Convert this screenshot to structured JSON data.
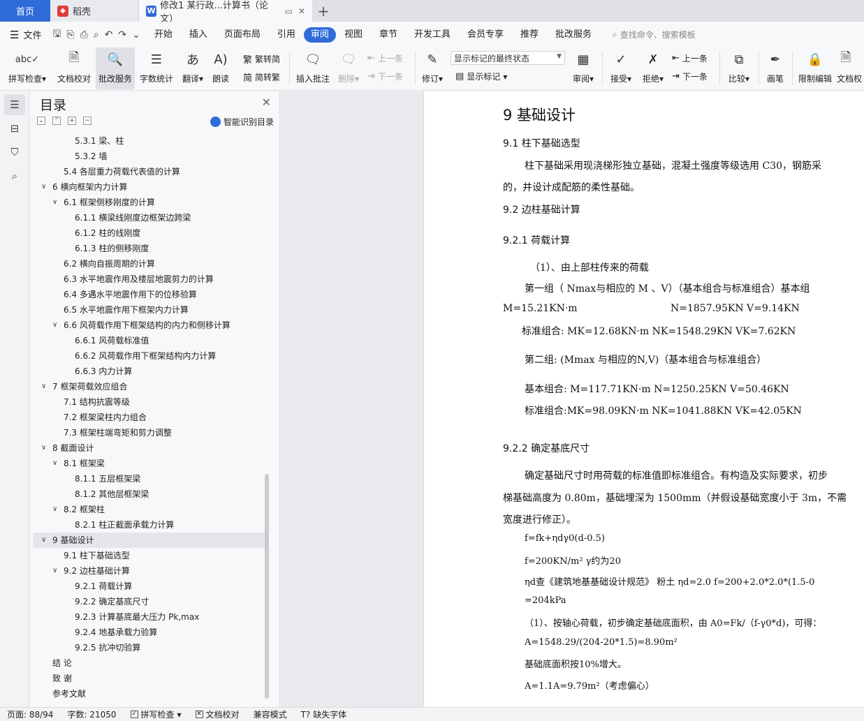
{
  "tabs": {
    "home": "首页",
    "daoke": "稻壳",
    "doc": "修改1 某行政...计算书（论文）"
  },
  "menu": {
    "file": "文件",
    "items": [
      "开始",
      "插入",
      "页面布局",
      "引用",
      "审阅",
      "视图",
      "章节",
      "开发工具",
      "会员专享",
      "推荐",
      "批改服务"
    ],
    "active_index": 4,
    "search": "查找命令、搜索模板"
  },
  "ribbon": {
    "spell": "拼写检查",
    "doc_check": "文档校对",
    "correction": "批改服务",
    "word_count": "字数统计",
    "translate": "翻译",
    "read_aloud": "朗读",
    "trad": "繁转简",
    "simp": "简转繁",
    "insert_comment": "插入批注",
    "delete": "删除",
    "prev": "上一条",
    "next": "下一条",
    "revise": "修订",
    "markup_state": "显示标记的最终状态",
    "show_markup": "显示标记",
    "review": "审阅",
    "accept": "接受",
    "reject": "拒绝",
    "prev2": "上一条",
    "next2": "下一条",
    "compare": "比较",
    "brush": "画笔",
    "restrict": "限制编辑",
    "doc_perm": "文档权"
  },
  "toc": {
    "title": "目录",
    "smart": "智能识别目录",
    "items": [
      {
        "label": "5.3.1 梁、柱",
        "level": 3
      },
      {
        "label": "5.3.2 墙",
        "level": 3
      },
      {
        "label": "5.4  各层重力荷载代表值的计算",
        "level": 2
      },
      {
        "label": "6 横向框架内力计算",
        "level": 1,
        "expanded": true
      },
      {
        "label": "6.1 框架侧移刚度的计算",
        "level": 2,
        "expanded": true
      },
      {
        "label": "6.1.1 横梁线刚度边框架边跨梁",
        "level": 3
      },
      {
        "label": "6.1.2 柱的线刚度",
        "level": 3
      },
      {
        "label": "6.1.3 柱的侧移刚度",
        "level": 3
      },
      {
        "label": "6.2 横向自振周期的计算",
        "level": 2
      },
      {
        "label": "6.3 水平地震作用及楼层地震剪力的计算",
        "level": 2
      },
      {
        "label": "6.4 多遇水平地震作用下的位移验算",
        "level": 2
      },
      {
        "label": "6.5 水平地震作用下框架内力计算",
        "level": 2
      },
      {
        "label": "6.6 风荷载作用下框架结构的内力和侧移计算",
        "level": 2,
        "expanded": true
      },
      {
        "label": "6.6.1 风荷载标准值",
        "level": 3
      },
      {
        "label": "6.6.2 风荷载作用下框架结构内力计算",
        "level": 3
      },
      {
        "label": "6.6.3 内力计算",
        "level": 3
      },
      {
        "label": "7 框架荷载效应组合",
        "level": 1,
        "expanded": true
      },
      {
        "label": "7.1 结构抗震等级",
        "level": 2
      },
      {
        "label": "7.2 框架梁柱内力组合",
        "level": 2
      },
      {
        "label": "7.3 框架柱端弯矩和剪力调整",
        "level": 2
      },
      {
        "label": "8 截面设计",
        "level": 1,
        "expanded": true
      },
      {
        "label": "8.1 框架梁",
        "level": 2,
        "expanded": true
      },
      {
        "label": "8.1.1 五层框架梁",
        "level": 3
      },
      {
        "label": "8.1.2 其他层框架梁",
        "level": 3
      },
      {
        "label": "8.2 框架柱",
        "level": 2,
        "expanded": true
      },
      {
        "label": "8.2.1 柱正截面承载力计算",
        "level": 3
      },
      {
        "label": "9 基础设计",
        "level": 1,
        "expanded": true,
        "selected": true
      },
      {
        "label": "9.1 柱下基础选型",
        "level": 2
      },
      {
        "label": "9.2 边柱基础计算",
        "level": 2,
        "expanded": true
      },
      {
        "label": "9.2.1 荷载计算",
        "level": 3
      },
      {
        "label": "9.2.2 确定基底尺寸",
        "level": 3
      },
      {
        "label": "9.2.3 计算基底最大压力 Pk,max",
        "level": 3
      },
      {
        "label": "9.2.4 地基承载力验算",
        "level": 3
      },
      {
        "label": "9.2.5 抗冲切验算",
        "level": 3
      },
      {
        "label": "结  论",
        "level": 1
      },
      {
        "label": "致  谢",
        "level": 1
      },
      {
        "label": "参考文献",
        "level": 1
      }
    ]
  },
  "doc": {
    "h1": "9 基础设计",
    "s91": "9.1 柱下基础选型",
    "p1": "柱下基础采用现浇梯形独立基础，混凝土强度等级选用 C30，钢筋采",
    "p1b": "的，并设计成配筋的柔性基础。",
    "s92": "9.2 边柱基础计算",
    "s921": "9.2.1 荷载计算",
    "l1": "（1）、由上部柱传来的荷载",
    "l2": "第一组（ Nmax与相应的 M 、V）（基本组合与标准组合）基本组",
    "l3a": "M=15.21KN·m",
    "l3b": "N=1857.95KN    V=9.14KN",
    "l4": "标准组合: MK=12.68KN·m NK=1548.29KN VK=7.62KN",
    "l5": "第二组: (Mmax 与相应的N,V)（基本组合与标准组合）",
    "l6": "基本组合: M=117.71KN·m         N=1250.25KN    V=50.46KN",
    "l7": "标准组合:MK=98.09KN·m NK=1041.88KN VK=42.05KN",
    "s922": "9.2.2 确定基底尺寸",
    "p2": "确定基础尺寸时用荷载的标准值即标准组合。有构造及实际要求，初步",
    "p2b": "梯基础高度为 0.80m，基础埋深为 1500mm（并假设基础宽度小于 3m，不需",
    "p2c": "宽度进行修正）。",
    "f1": "f=fk+ηdγ0(d-0.5)",
    "f2": "f=200KN/m²              γ约为20",
    "f3": "ηd查《建筑地基基础设计规范》     粉土    ηd=2.0 f=200+2.0*2.0*(1.5-0",
    "f4": "=204kPa",
    "f5": "（1）、按轴心荷载，初步确定基础底面积，由 A0=Fk/（f-γ0*d)，可得：",
    "f6": "A=1548.29/(204-20*1.5)=8.90m²",
    "f7": "基础底面积按10%增大。",
    "f8": "A=1.1A=9.79m²（考虑偏心）"
  },
  "status": {
    "page": "页面: 88/94",
    "words": "字数: 21050",
    "spell": "拼写检查",
    "check": "文档校对",
    "compat": "兼容模式",
    "missing_font": "缺失字体"
  },
  "colors": {
    "accent": "#2f6bd9"
  }
}
